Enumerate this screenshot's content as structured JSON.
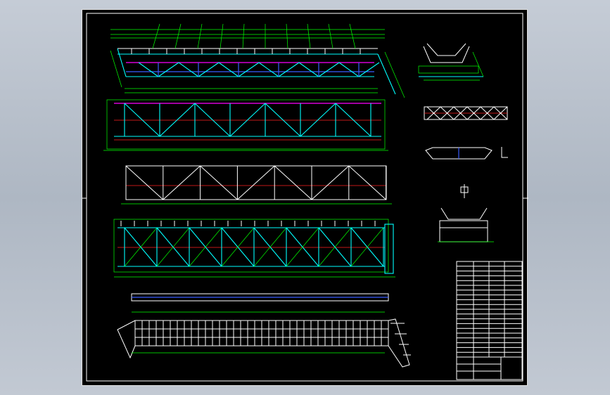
{
  "viewer": {
    "background_top": "#c5ccd6",
    "canvas_color": "#000000"
  },
  "drawing": {
    "line_colors": {
      "outline": "#ffffff",
      "dimension": "#00ff00",
      "member": "#00ffff",
      "centerline": "#ff2020",
      "hidden": "#3a5cff",
      "highlight": "#ff00ff",
      "annotation": "#ffff00"
    },
    "views": [
      {
        "name": "front-elevation-with-bends"
      },
      {
        "name": "side-truss-elevation"
      },
      {
        "name": "lower-truss-elevation"
      },
      {
        "name": "plan-view-frame"
      },
      {
        "name": "walkway-grating-plan"
      },
      {
        "name": "section-view-a"
      },
      {
        "name": "section-view-b"
      },
      {
        "name": "section-view-c"
      },
      {
        "name": "section-view-d"
      }
    ]
  }
}
